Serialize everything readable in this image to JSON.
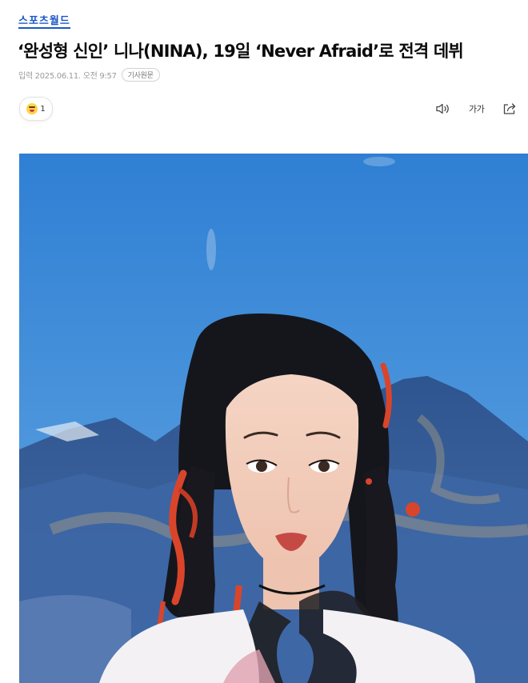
{
  "header": {
    "brand_name": "스포츠월드"
  },
  "article": {
    "headline": "‘완성형 신인’ 니나(NINA), 19일 ‘Never Afraid’로 전격 데뷔",
    "meta": {
      "published": "입력 2025.06.11. 오전 9:57",
      "original_tag": "기사원문"
    },
    "reaction": {
      "icon": "laughing-emoji-icon",
      "count": "1"
    },
    "toolbar": {
      "speaker_icon": "speaker-icon",
      "font_size_label": "가가",
      "share_icon": "share-icon"
    },
    "photo": {
      "subject": "portrait-photo"
    }
  },
  "colors": {
    "brand": "#1a57c9",
    "sky": "#4a8fd8",
    "mountain": "#3b5f9c"
  }
}
